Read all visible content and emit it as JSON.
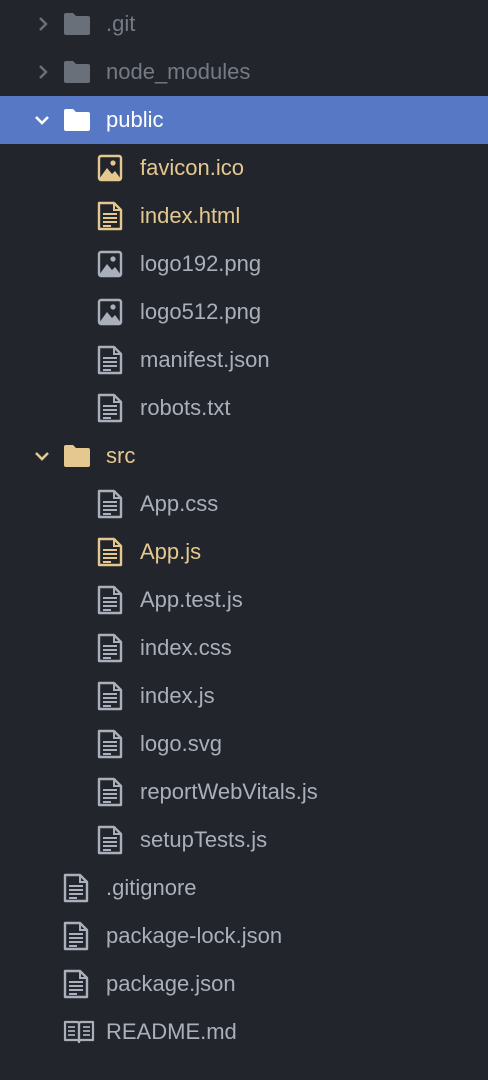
{
  "colors": {
    "background": "#22252b",
    "selection": "#5778c5",
    "text": "#a9b0bb",
    "ignored_text": "#757b85",
    "modified_text": "#e4c890",
    "selected_text": "#ffffff"
  },
  "tree": {
    "items": [
      {
        "label": ".git",
        "kind": "folder",
        "state": "ignored",
        "expanded": false,
        "icon": "folder-icon"
      },
      {
        "label": "node_modules",
        "kind": "folder",
        "state": "ignored",
        "expanded": false,
        "icon": "folder-icon"
      },
      {
        "label": "public",
        "kind": "folder",
        "state": "selected",
        "expanded": true,
        "icon": "folder-icon"
      },
      {
        "label": "favicon.ico",
        "kind": "file",
        "state": "modified",
        "icon": "image-file-icon"
      },
      {
        "label": "index.html",
        "kind": "file",
        "state": "modified",
        "icon": "text-file-icon"
      },
      {
        "label": "logo192.png",
        "kind": "file",
        "state": "normal",
        "icon": "image-file-icon"
      },
      {
        "label": "logo512.png",
        "kind": "file",
        "state": "normal",
        "icon": "image-file-icon"
      },
      {
        "label": "manifest.json",
        "kind": "file",
        "state": "normal",
        "icon": "text-file-icon"
      },
      {
        "label": "robots.txt",
        "kind": "file",
        "state": "normal",
        "icon": "text-file-icon"
      },
      {
        "label": "src",
        "kind": "folder",
        "state": "modified",
        "expanded": true,
        "icon": "folder-icon"
      },
      {
        "label": "App.css",
        "kind": "file",
        "state": "normal",
        "icon": "text-file-icon"
      },
      {
        "label": "App.js",
        "kind": "file",
        "state": "modified",
        "icon": "text-file-icon"
      },
      {
        "label": "App.test.js",
        "kind": "file",
        "state": "normal",
        "icon": "text-file-icon"
      },
      {
        "label": "index.css",
        "kind": "file",
        "state": "normal",
        "icon": "text-file-icon"
      },
      {
        "label": "index.js",
        "kind": "file",
        "state": "normal",
        "icon": "text-file-icon"
      },
      {
        "label": "logo.svg",
        "kind": "file",
        "state": "normal",
        "icon": "text-file-icon"
      },
      {
        "label": "reportWebVitals.js",
        "kind": "file",
        "state": "normal",
        "icon": "text-file-icon"
      },
      {
        "label": "setupTests.js",
        "kind": "file",
        "state": "normal",
        "icon": "text-file-icon"
      },
      {
        "label": ".gitignore",
        "kind": "file",
        "state": "normal",
        "icon": "text-file-icon"
      },
      {
        "label": "package-lock.json",
        "kind": "file",
        "state": "normal",
        "icon": "text-file-icon"
      },
      {
        "label": "package.json",
        "kind": "file",
        "state": "normal",
        "icon": "text-file-icon"
      },
      {
        "label": "README.md",
        "kind": "file",
        "state": "normal",
        "icon": "book-icon"
      }
    ]
  }
}
